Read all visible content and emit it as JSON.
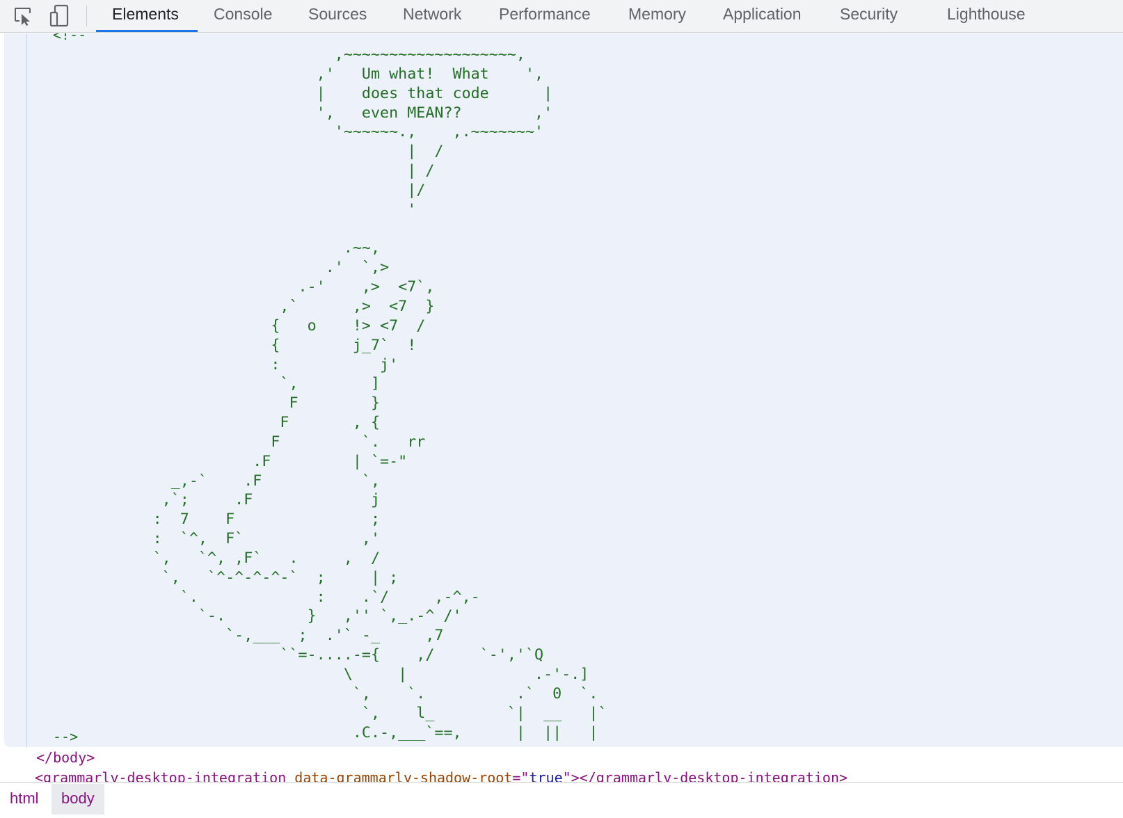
{
  "toolbar": {
    "icons": [
      "inspect-element-icon",
      "device-toolbar-icon"
    ],
    "tabs": [
      "Elements",
      "Console",
      "Sources",
      "Network",
      "Performance",
      "Memory",
      "Application",
      "Security",
      "Lighthouse"
    ],
    "active_tab": "Elements"
  },
  "elements": {
    "comment_open": "<!--",
    "ascii_art": "                               ,~~~~~~~~~~~~~~~~~~~,\n                             ,'   Um what!  What    ',\n                             |    does that code      |\n                             ',   even MEAN??        ,'\n                               '~~~~~~.,    ,.~~~~~~~'\n                                       |  /\n                                       | /\n                                       |/\n                                       '\n\n                                .~~,\n                              .'  `,>\n                           .-'    ,>  <7`,\n                         ,`      ,>  <7  }\n                        {   o    !> <7  /\n                        {        j_7`  !\n                        :           j'\n                         `,        ]\n                          F        }\n                         F       , {\n                        F         `.   rr\n                      .F         | `=-\"\n             _,-`    .F           `,\n            ,`;     .F             j\n           :  7    F               ;\n           :  `^,  F`             ,'\n           `,   `^, ,F`   .     ,  /\n            `,   `^-^-^-^-`  ;     | ;\n              `.             :    .`/     ,-^,-\n                `-.         }   ,'' `,_.-^ /'\n                   `-,___  ;  .'` -_     ,7\n                         ``=-....-={    ,/     `-','`Q\n                                \\     |              .-'-.]\n                                 `,    `.          .`  0  `.\n                                  `,    l_        `|  __   |`\n                                 .C.-,___`==,      |  ||   |",
    "comment_close": "-->",
    "close_tag": "</body>",
    "next_node": {
      "tag_open": "<grammarly-desktop-integration",
      "attr_name": "data-grammarly-shadow-root",
      "attr_value": "true",
      "tag_close": "></grammarly-desktop-integration>"
    }
  },
  "breadcrumbs": [
    "html",
    "body"
  ],
  "colors": {
    "comment": "#236e25",
    "tag": "#881280",
    "attr_name": "#994500",
    "attr_value": "#1a1aa6",
    "selected_bg": "#edf2fa",
    "active_tab_underline": "#1a73e8"
  }
}
